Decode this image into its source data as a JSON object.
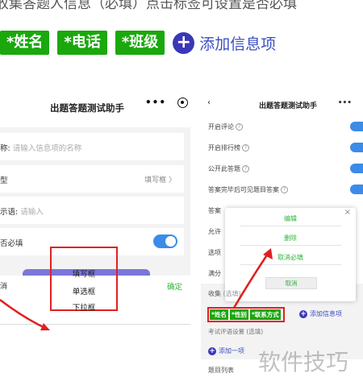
{
  "caption": "收集答题人信息（必填）点击标签可设置是否必填",
  "big_tags": [
    "*姓名",
    "*电话",
    "*班级"
  ],
  "add_info_label": "添加信息项",
  "left_phone": {
    "title": "出题答题测试助手",
    "name_label": "称:",
    "name_placeholder": "请输入信息项的名称",
    "type_label": "型",
    "type_value": "填写框 〉",
    "hint_label": "示语:",
    "hint_placeholder": "请输入",
    "required_label": "否必填",
    "sheet_cancel": "消",
    "sheet_confirm": "确定",
    "picker_options": [
      "填写框",
      "单选框",
      "下拉框"
    ]
  },
  "right_phone": {
    "back": "‹",
    "title": "出题答题测试助手",
    "rows": [
      "开启评论",
      "开启排行榜",
      "公开此答题",
      "答案完毕后可见题目答案",
      "答案",
      "允许",
      "选项",
      "满分"
    ],
    "popup_options": [
      "编辑",
      "删除",
      "取消必填"
    ],
    "popup_cancel": "取消",
    "collect_label": "收集",
    "collect_suffix": "(选填)",
    "small_tags": [
      "*姓名",
      "*性别",
      "*联系方式"
    ],
    "add_info_label": "添加信息项",
    "eval_label": "考试评语设置 (选填)",
    "add_one_label": "添加一项",
    "question_list_label": "题目列表"
  },
  "watermark": "软件技巧",
  "colors": {
    "tag_green": "#1aa80c",
    "accent_blue": "#3a4ec2",
    "highlight_red": "#e02020",
    "toggle_blue": "#3b8be8"
  }
}
